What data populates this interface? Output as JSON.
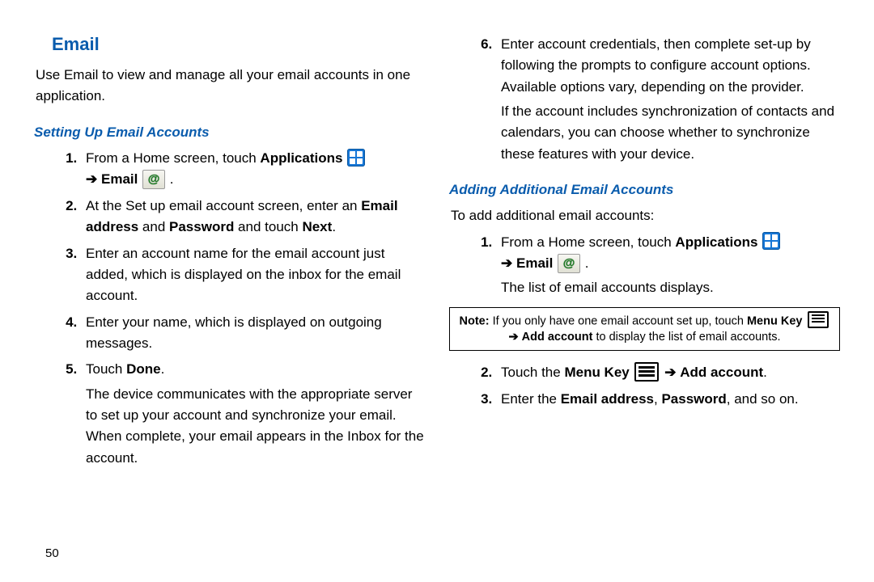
{
  "page_number": "50",
  "arrow": "➔",
  "left": {
    "title": "Email",
    "intro": "Use Email to view and manage all your email accounts in one application.",
    "sub": "Setting Up Email Accounts",
    "s1a": "From a Home screen, touch ",
    "s1b": "Applications",
    "s1c": "Email",
    "s1d": " .",
    "s2a": "At the Set up email account screen, enter an ",
    "s2b": "Email address",
    "s2c": " and ",
    "s2d": "Password",
    "s2e": " and touch ",
    "s2f": "Next",
    "s2g": ".",
    "s3": "Enter an account name for the email account just added, which is displayed on the inbox for the email account.",
    "s4": "Enter your name, which is displayed on outgoing messages.",
    "s5a": "Touch ",
    "s5b": "Done",
    "s5c": ".",
    "s5after": "The device communicates with the appropriate server to set up your account and synchronize your email. When complete, your email appears in the Inbox for the account."
  },
  "right": {
    "s6": "Enter account credentials, then complete set-up by following the prompts to configure account options. Available options vary, depending on the provider.",
    "s6after": "If the account includes synchronization of contacts and calendars, you can choose whether to synchronize these features with your device.",
    "sub": "Adding Additional Email Accounts",
    "intro2": "To add additional email accounts:",
    "a1a": "From a Home screen, touch ",
    "a1b": "Applications",
    "a1c": "Email",
    "a1d": " .",
    "a1after": "The list of email accounts displays.",
    "note_lbl": "Note:",
    "note_a": " If you only have one email account set up, touch ",
    "note_b": "Menu Key",
    "note_c": "Add account",
    "note_d": " to display the list of email accounts.",
    "a2a": "Touch the ",
    "a2b": "Menu Key",
    "a2c": "Add account",
    "a2d": ".",
    "a3a": "Enter the ",
    "a3b": "Email address",
    "a3c": ", ",
    "a3d": "Password",
    "a3e": ", and so on."
  }
}
